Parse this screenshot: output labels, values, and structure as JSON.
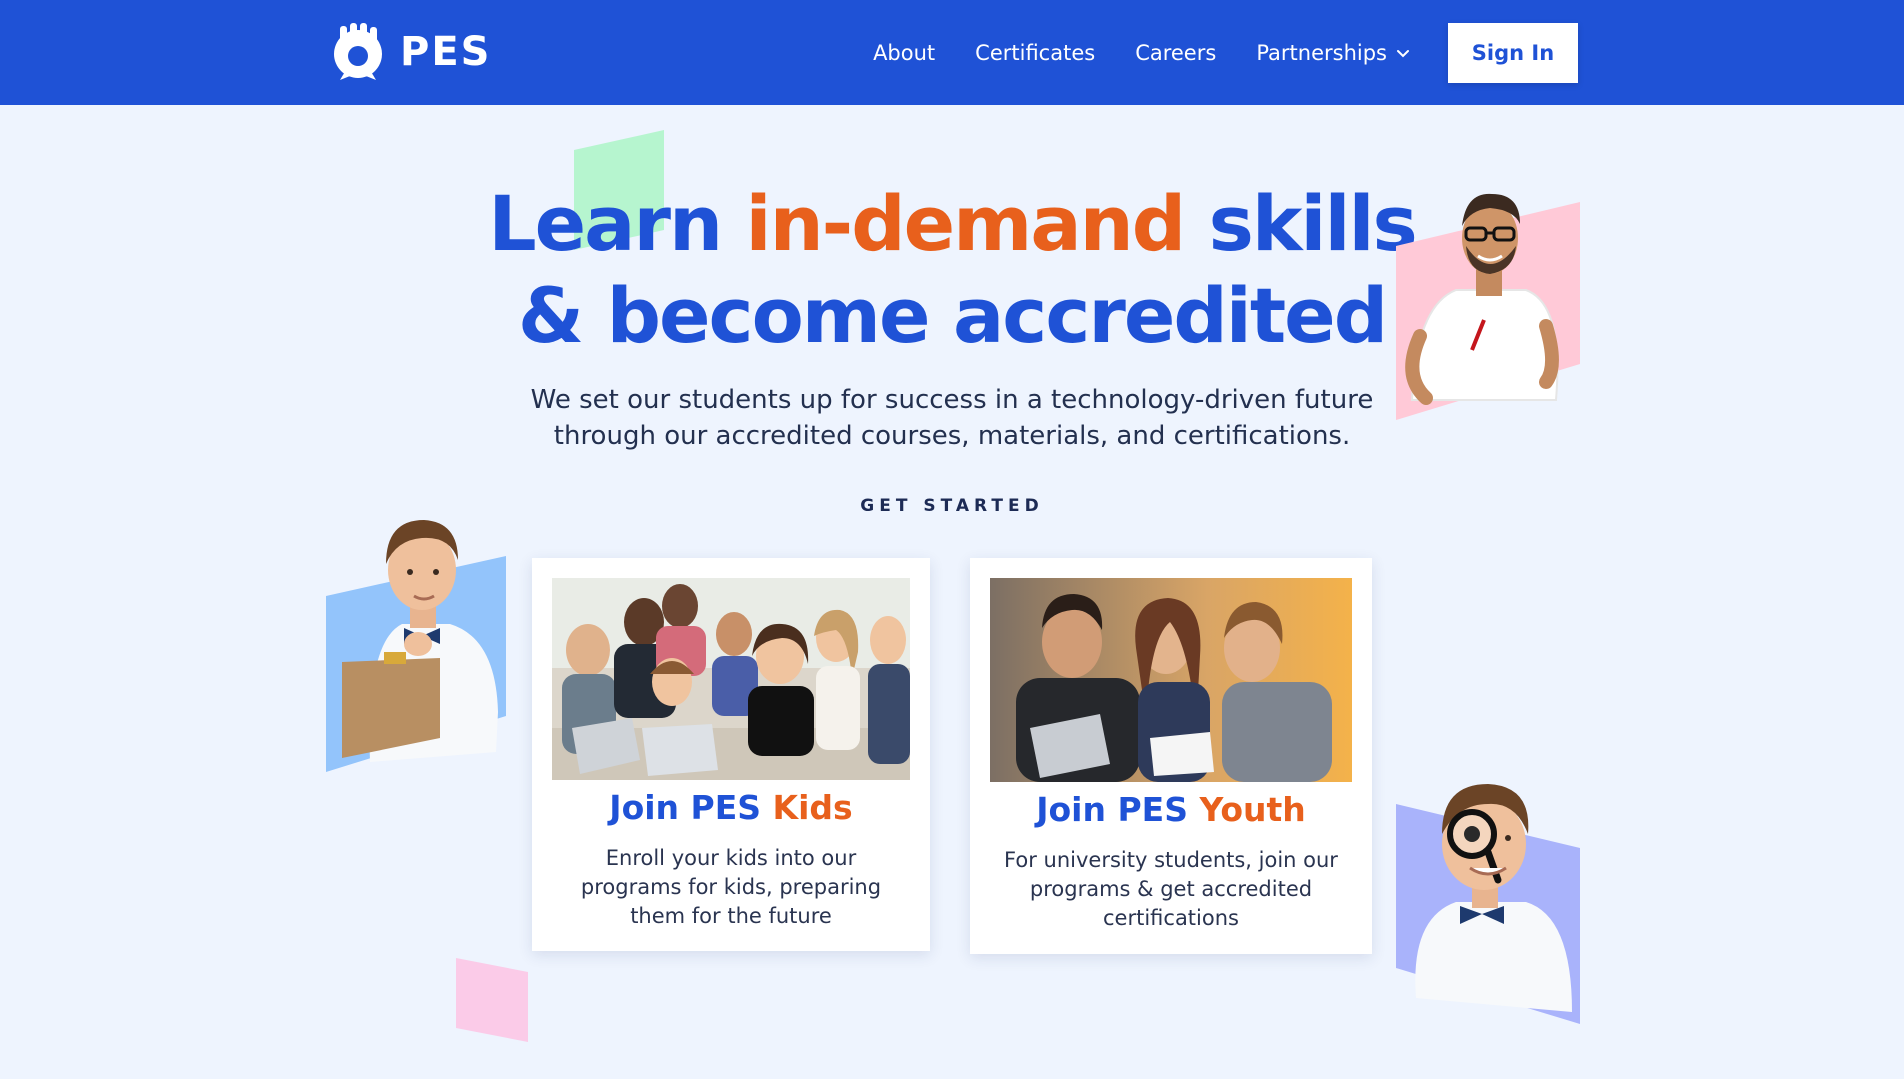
{
  "nav": {
    "logo_text": "PES",
    "links": [
      {
        "label": "About"
      },
      {
        "label": "Certificates"
      },
      {
        "label": "Careers"
      },
      {
        "label": "Partnerships"
      }
    ],
    "sign_in_label": "Sign In"
  },
  "hero": {
    "headline_part1": "Learn ",
    "headline_accent": "in-demand",
    "headline_part2": " skills",
    "headline_line2": "& become accredited",
    "subtitle": "We set our students up for success in a technology-driven future through our accredited courses, materials, and certifications.",
    "get_started": "GET STARTED"
  },
  "cards": {
    "kids": {
      "title_prefix": "Join PES ",
      "title_accent": "Kids",
      "description": "Enroll your kids into our programs for kids, preparing them for the future"
    },
    "youth": {
      "title_prefix": "Join PES ",
      "title_accent": "Youth",
      "description": "For university students, join our programs & get accredited certifications"
    }
  },
  "colors": {
    "nav_bg": "#1f52d6",
    "page_bg": "#eef4fe",
    "primary_blue": "#1f52d6",
    "accent_orange": "#e8601c",
    "deco_green": "#b6f5cf",
    "deco_pink": "#ffc9d7",
    "deco_blue": "#93c4fb",
    "deco_lavender": "#a9b3fb",
    "deco_magenta": "#fbcbe8"
  },
  "icons": [
    "pes-logo-icon",
    "chevron-down-icon"
  ]
}
